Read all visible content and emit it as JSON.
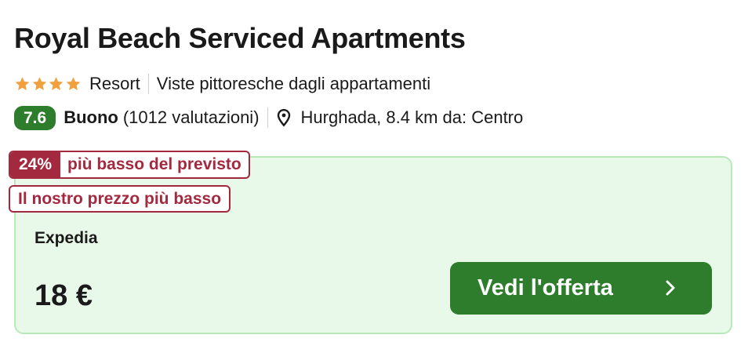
{
  "hotel": {
    "name": "Royal Beach Serviced Apartments",
    "star_count": 4,
    "star_color": "#f2a03d",
    "category": "Resort",
    "highlight": "Viste pittoresche dagli appartamenti",
    "score": "7.6",
    "score_color": "#2d7d2d",
    "rating_word": "Buono",
    "review_count": "(1012 valutazioni)",
    "location": "Hurghada, 8.4 km da: Centro",
    "location_icon": "map-pin-icon"
  },
  "deal": {
    "discount_percent": "24%",
    "discount_text": "più basso del previsto",
    "lowest_price_badge": "Il nostro prezzo più basso",
    "badge_color": "#a3293f",
    "provider": "Expedia",
    "price": "18 €",
    "cta_label": "Vedi l'offerta",
    "cta_icon": "chevron-right-icon",
    "card_background": "#e9f9e9"
  }
}
